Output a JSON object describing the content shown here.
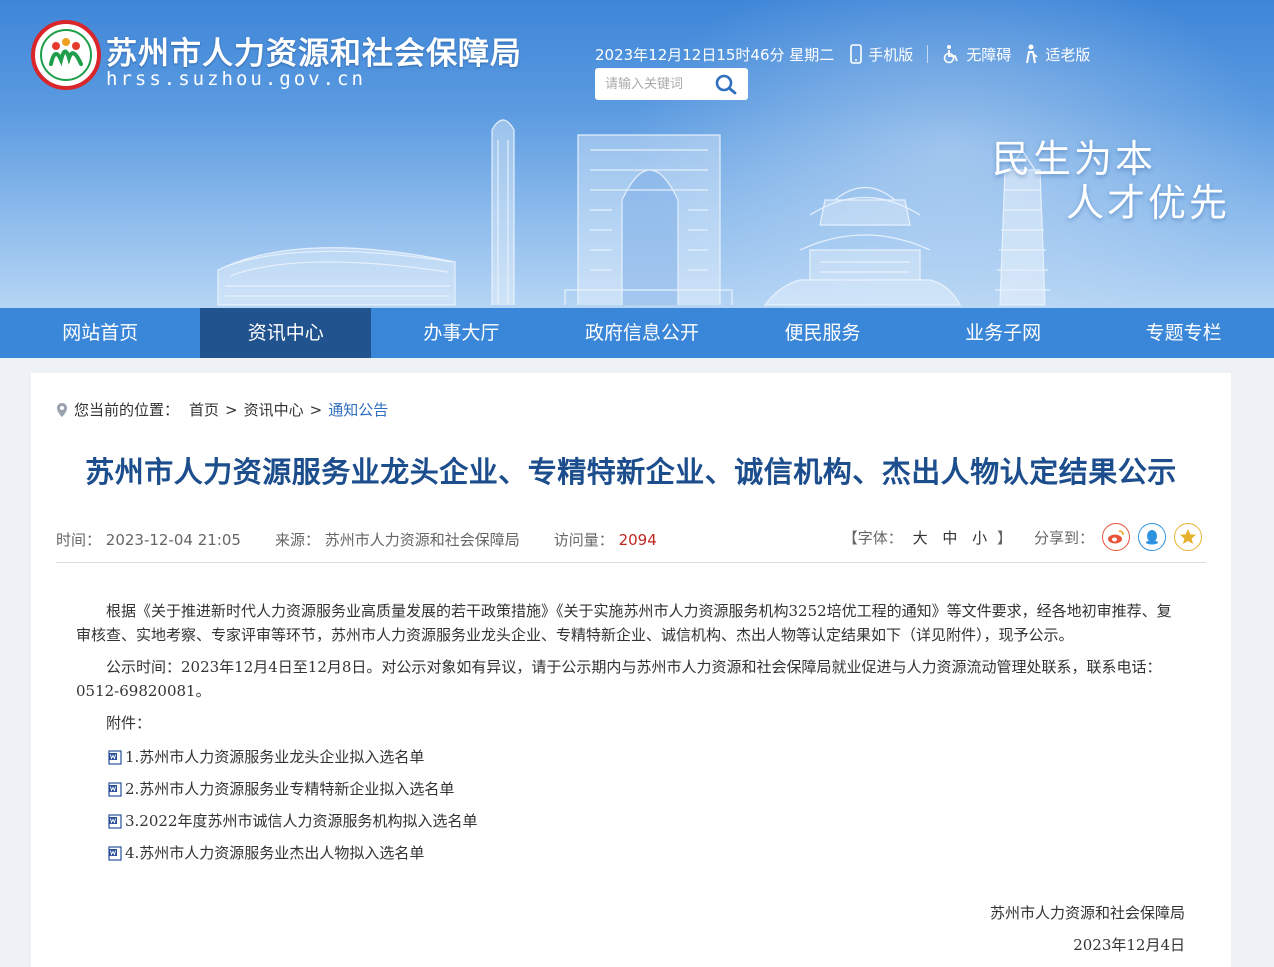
{
  "header": {
    "site_name": "苏州市人力资源和社会保障局",
    "site_domain": "hrss.suzhou.gov.cn",
    "datetime": "2023年12月12日15时46分 星期二",
    "links": {
      "mobile": "手机版",
      "accessible": "无障碍",
      "elderly": "适老版"
    },
    "search": {
      "placeholder": "请输入关键词"
    },
    "slogan": {
      "line1": "民生为本",
      "line2": "人才优先"
    }
  },
  "nav": {
    "items": [
      {
        "label": "网站首页"
      },
      {
        "label": "资讯中心"
      },
      {
        "label": "办事大厅"
      },
      {
        "label": "政府信息公开"
      },
      {
        "label": "便民服务"
      },
      {
        "label": "业务子网"
      },
      {
        "label": "专题专栏"
      }
    ],
    "active_index": 1
  },
  "breadcrumb": {
    "prefix": "您当前的位置：",
    "items": [
      "首页",
      "资讯中心",
      "通知公告"
    ],
    "separator": ">"
  },
  "article": {
    "title": "苏州市人力资源服务业龙头企业、专精特新企业、诚信机构、杰出人物认定结果公示",
    "meta": {
      "time_label": "时间：",
      "time": "2023-12-04 21:05",
      "source_label": "来源：",
      "source": "苏州市人力资源和社会保障局",
      "views_label": "访问量：",
      "views": "2094"
    },
    "font_tool": {
      "open": "【字体：",
      "large": "大",
      "medium": "中",
      "small": "小",
      "close": "】"
    },
    "share_label": "分享到：",
    "paragraphs": [
      "根据《关于推进新时代人力资源服务业高质量发展的若干政策措施》《关于实施苏州市人力资源服务机构3252培优工程的通知》等文件要求，经各地初审推荐、复审核查、实地考察、专家评审等环节，苏州市人力资源服务业龙头企业、专精特新企业、诚信机构、杰出人物等认定结果如下（详见附件），现予公示。",
      "公示时间：2023年12月4日至12月8日。对公示对象如有异议，请于公示期内与苏州市人力资源和社会保障局就业促进与人力资源流动管理处联系，联系电话：0512-69820081。"
    ],
    "attachments_label": "附件：",
    "attachments": [
      "1.苏州市人力资源服务业龙头企业拟入选名单",
      "2.苏州市人力资源服务业专精特新企业拟入选名单",
      "3.2022年度苏州市诚信人力资源服务机构拟入选名单",
      "4.苏州市人力资源服务业杰出人物拟入选名单"
    ],
    "signature": {
      "org": "苏州市人力资源和社会保障局",
      "date": "2023年12月4日"
    }
  },
  "colors": {
    "nav_bg": "#3a86d8",
    "nav_active": "#21538f",
    "title": "#1c4d8c",
    "views": "#c0261e",
    "breadcrumb_current": "#2f6fbf"
  }
}
